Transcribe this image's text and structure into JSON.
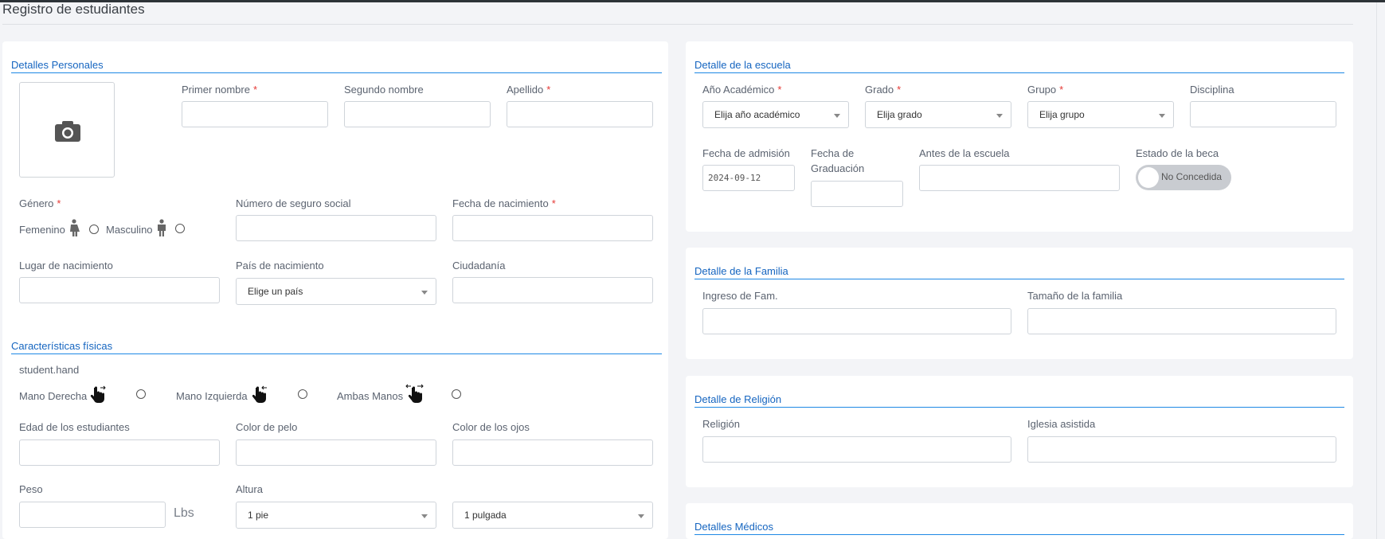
{
  "page": {
    "title": "Registro de estudiantes"
  },
  "personal": {
    "title": "Detalles Personales",
    "first_name_label": "Primer nombre",
    "middle_name_label": "Segundo nombre",
    "last_name_label": "Apellido",
    "gender_label": "Género",
    "female_label": "Femenino",
    "male_label": "Masculino",
    "ssn_label": "Número de seguro social",
    "dob_label": "Fecha de nacimiento",
    "birthplace_label": "Lugar de nacimiento",
    "birth_country_label": "País de nacimiento",
    "birth_country_value": "Elige un país",
    "citizenship_label": "Ciudadanía",
    "required_mark": "*"
  },
  "physical": {
    "title": "Características físicas",
    "hand_label": "student.hand",
    "right_hand_label": "Mano Derecha",
    "left_hand_label": "Mano Izquierda",
    "both_hands_label": "Ambas Manos",
    "age_label": "Edad de los estudiantes",
    "hair_label": "Color de pelo",
    "eye_label": "Color de los ojos",
    "weight_label": "Peso",
    "weight_unit": "Lbs",
    "height_label": "Altura",
    "height_feet_value": "1 pie",
    "height_inches_value": "1 pulgada"
  },
  "school": {
    "title": "Detalle de la escuela",
    "year_label": "Año Académico",
    "year_value": "Elija año académico",
    "grade_label": "Grado",
    "grade_value": "Elija grado",
    "group_label": "Grupo",
    "group_value": "Elija grupo",
    "discipline_label": "Disciplina",
    "admission_label": "Fecha de admisión",
    "admission_value": "2024-09-12",
    "graduation_label_1": "Fecha de",
    "graduation_label_2": "Graduación",
    "previous_school_label": "Antes de la escuela",
    "scholarship_label": "Estado de la beca",
    "scholarship_value": "No Concedida"
  },
  "family": {
    "title": "Detalle de la Familia",
    "income_label": "Ingreso de Fam.",
    "size_label": "Tamaño de la familia"
  },
  "religion": {
    "title": "Detalle de Religión",
    "religion_label": "Religión",
    "church_label": "Iglesia asistida"
  },
  "medical": {
    "title": "Detalles Médicos"
  },
  "colors": {
    "accent": "#1565c0",
    "required": "#e53935"
  },
  "icons": [
    "camera-icon",
    "female-icon",
    "male-icon",
    "right-hand-icon",
    "left-hand-icon",
    "both-hands-icon",
    "dropdown-caret-icon"
  ]
}
